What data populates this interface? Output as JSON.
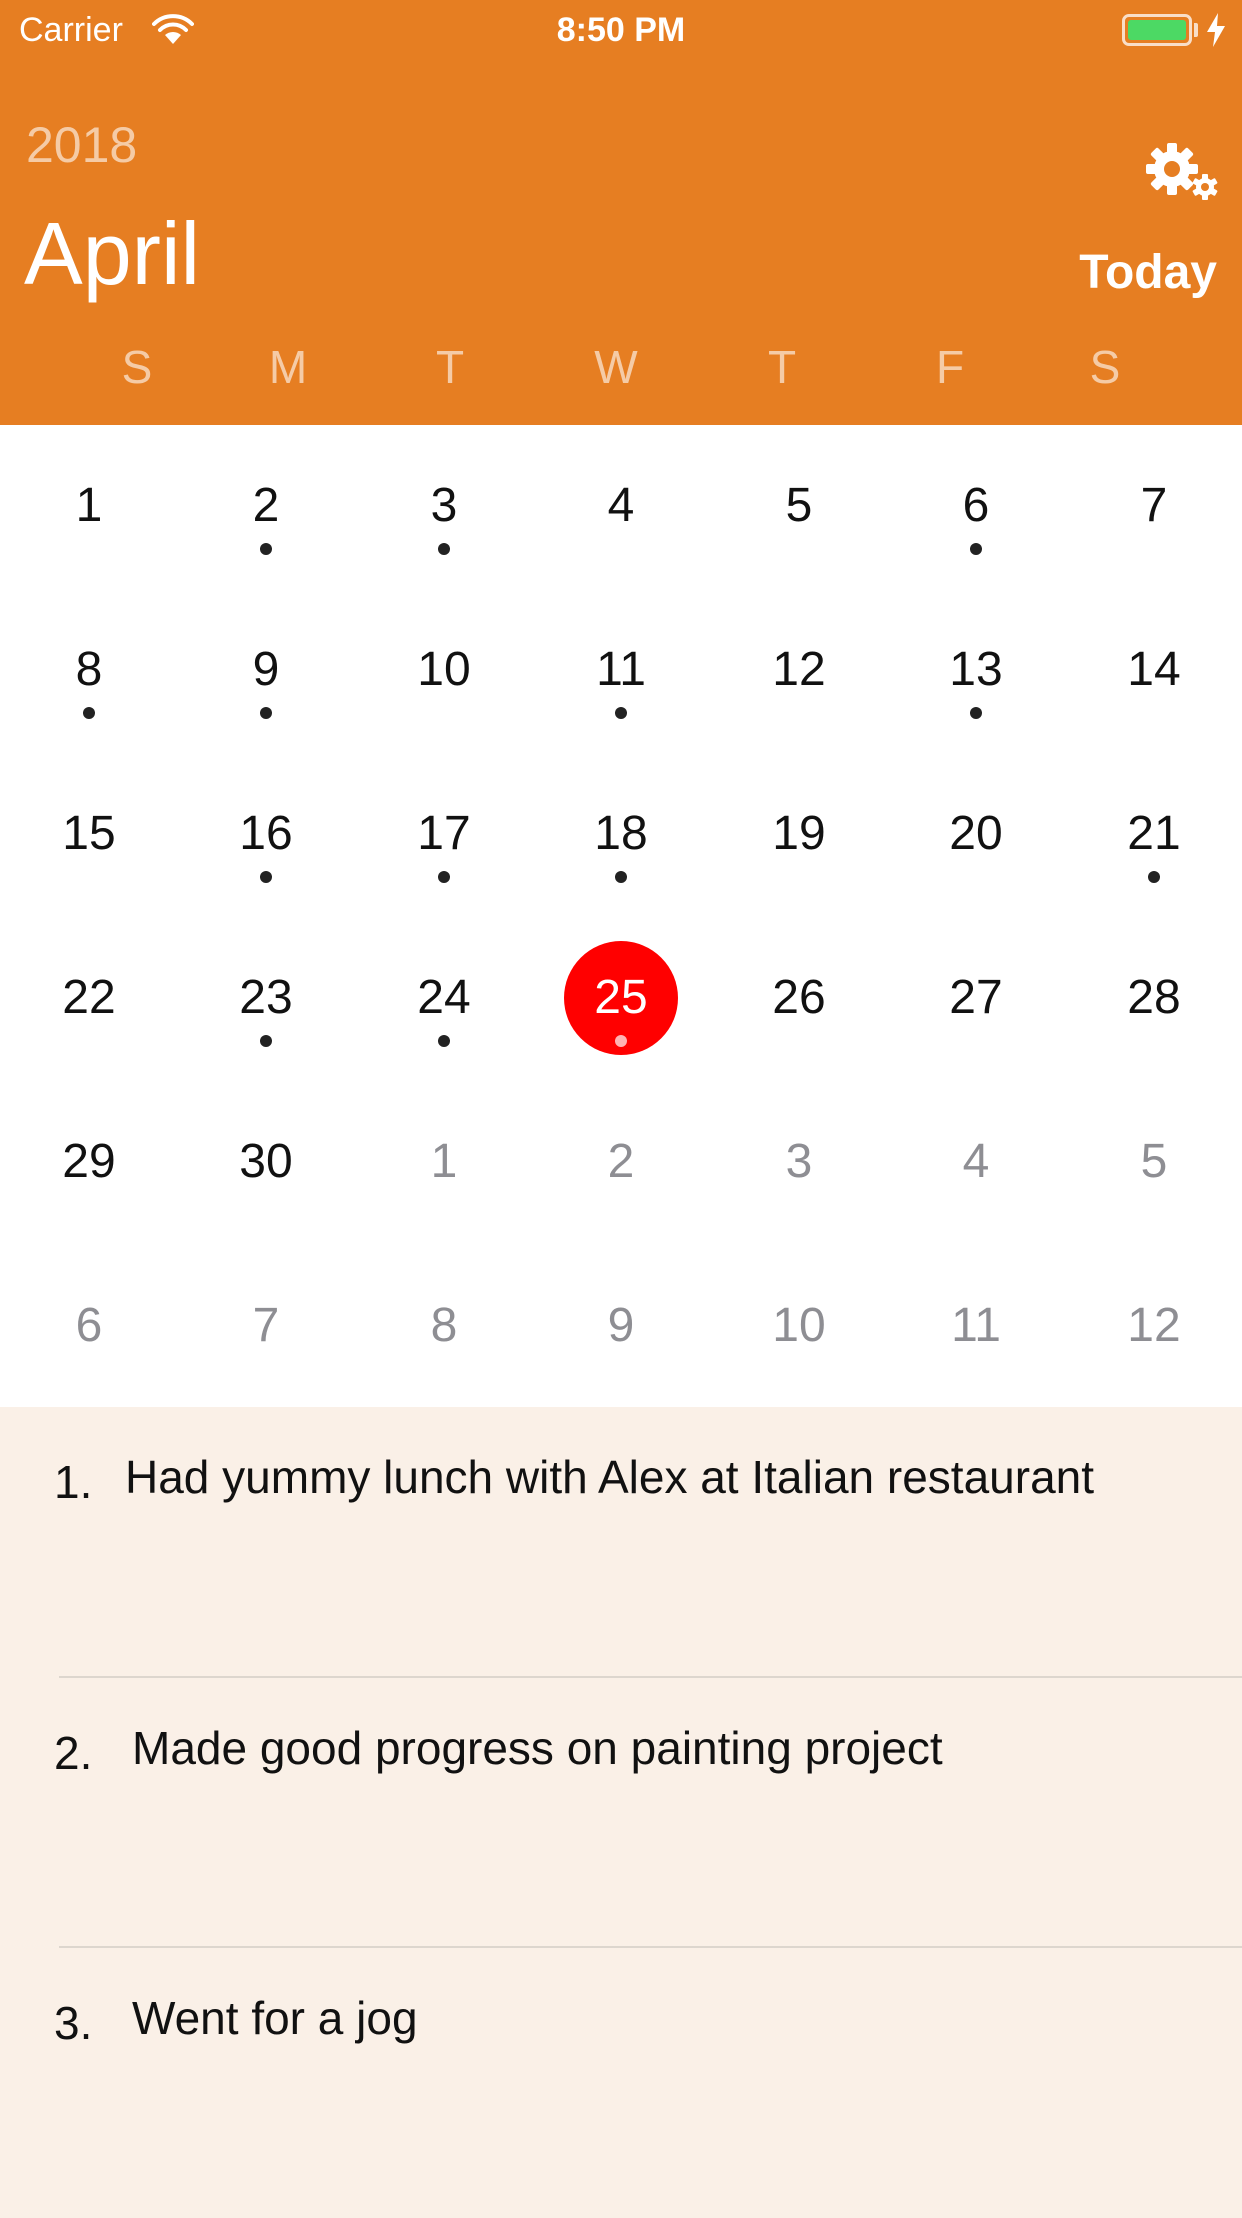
{
  "status_bar": {
    "carrier": "Carrier",
    "time": "8:50 PM"
  },
  "header": {
    "year": "2018",
    "month": "April",
    "today_label": "Today",
    "settings_icon": "gear-icon"
  },
  "weekdays": [
    "S",
    "M",
    "T",
    "W",
    "T",
    "F",
    "S"
  ],
  "calendar": {
    "selected_day": "25",
    "weeks": [
      [
        {
          "day": "1",
          "other": false,
          "dot": false
        },
        {
          "day": "2",
          "other": false,
          "dot": true
        },
        {
          "day": "3",
          "other": false,
          "dot": true
        },
        {
          "day": "4",
          "other": false,
          "dot": false
        },
        {
          "day": "5",
          "other": false,
          "dot": false
        },
        {
          "day": "6",
          "other": false,
          "dot": true
        },
        {
          "day": "7",
          "other": false,
          "dot": false
        }
      ],
      [
        {
          "day": "8",
          "other": false,
          "dot": true
        },
        {
          "day": "9",
          "other": false,
          "dot": true
        },
        {
          "day": "10",
          "other": false,
          "dot": false
        },
        {
          "day": "11",
          "other": false,
          "dot": true
        },
        {
          "day": "12",
          "other": false,
          "dot": false
        },
        {
          "day": "13",
          "other": false,
          "dot": true
        },
        {
          "day": "14",
          "other": false,
          "dot": false
        }
      ],
      [
        {
          "day": "15",
          "other": false,
          "dot": false
        },
        {
          "day": "16",
          "other": false,
          "dot": true
        },
        {
          "day": "17",
          "other": false,
          "dot": true
        },
        {
          "day": "18",
          "other": false,
          "dot": true
        },
        {
          "day": "19",
          "other": false,
          "dot": false
        },
        {
          "day": "20",
          "other": false,
          "dot": false
        },
        {
          "day": "21",
          "other": false,
          "dot": true
        }
      ],
      [
        {
          "day": "22",
          "other": false,
          "dot": false
        },
        {
          "day": "23",
          "other": false,
          "dot": true
        },
        {
          "day": "24",
          "other": false,
          "dot": true
        },
        {
          "day": "25",
          "other": false,
          "dot": true,
          "selected": true
        },
        {
          "day": "26",
          "other": false,
          "dot": false
        },
        {
          "day": "27",
          "other": false,
          "dot": false
        },
        {
          "day": "28",
          "other": false,
          "dot": false
        }
      ],
      [
        {
          "day": "29",
          "other": false,
          "dot": false
        },
        {
          "day": "30",
          "other": false,
          "dot": false
        },
        {
          "day": "1",
          "other": true,
          "dot": false
        },
        {
          "day": "2",
          "other": true,
          "dot": false
        },
        {
          "day": "3",
          "other": true,
          "dot": false
        },
        {
          "day": "4",
          "other": true,
          "dot": false
        },
        {
          "day": "5",
          "other": true,
          "dot": false
        }
      ],
      [
        {
          "day": "6",
          "other": true,
          "dot": false
        },
        {
          "day": "7",
          "other": true,
          "dot": false
        },
        {
          "day": "8",
          "other": true,
          "dot": false
        },
        {
          "day": "9",
          "other": true,
          "dot": false
        },
        {
          "day": "10",
          "other": true,
          "dot": false
        },
        {
          "day": "11",
          "other": true,
          "dot": false
        },
        {
          "day": "12",
          "other": true,
          "dot": false
        }
      ]
    ]
  },
  "entries": [
    {
      "number": "1.",
      "text": "Had yummy lunch with Alex at Italian restaurant"
    },
    {
      "number": "2.",
      "text": "Made good progress on painting project"
    },
    {
      "number": "3.",
      "text": "Went for a jog"
    }
  ],
  "colors": {
    "accent": "#E67E22",
    "selected": "#FF0000",
    "entries_background": "#FAF0E7"
  }
}
